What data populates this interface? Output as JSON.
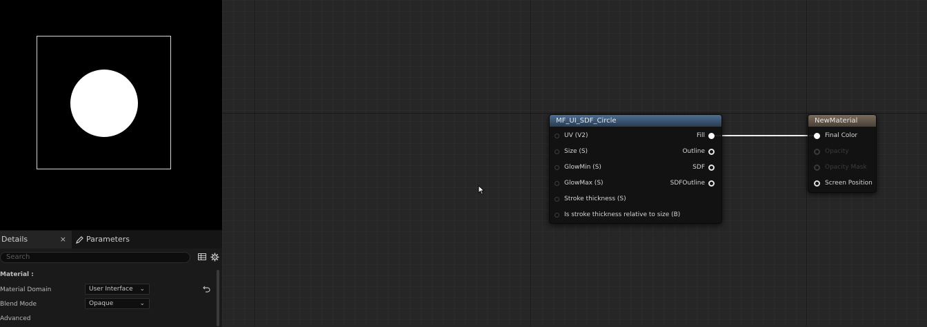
{
  "details_panel": {
    "tab_details": "Details",
    "tab_close": "×",
    "tab_parameters": "Parameters",
    "search_placeholder": "Search",
    "section_material": "Material :",
    "material_domain_label": "Material Domain",
    "material_domain_value": "User Interface",
    "blend_mode_label": "Blend Mode",
    "blend_mode_value": "Opaque",
    "advanced_label": "Advanced"
  },
  "graph": {
    "function_node": {
      "title": "MF_UI_SDF_Circle",
      "inputs": [
        "UV (V2)",
        "Size (S)",
        "GlowMin (S)",
        "GlowMax (S)",
        "Stroke thickness (S)",
        "Is stroke thickness relative to size (B)"
      ],
      "outputs": [
        "Fill",
        "Outline",
        "SDF",
        "SDFOutline"
      ]
    },
    "material_node": {
      "title": "NewMaterial",
      "inputs": [
        "Final Color",
        "Opacity",
        "Opacity Mask",
        "Screen Position"
      ]
    }
  },
  "colors": {
    "function_header": "#3f5d7e",
    "material_header": "#6a5e50",
    "graph_background": "#262626"
  }
}
